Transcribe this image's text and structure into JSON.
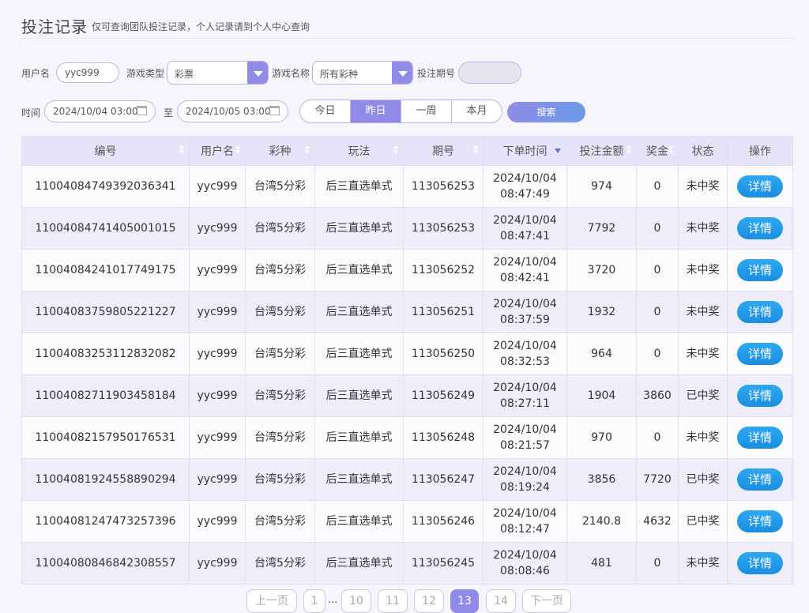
{
  "header": {
    "title": "投注记录",
    "subtitle": "仅可查询团队投注记录，个人记录请到个人中心查询"
  },
  "filters": {
    "username_label": "用户名",
    "username_value": "yyc999",
    "game_type_label": "游戏类型",
    "game_type_value": "彩票",
    "game_name_label": "游戏名称",
    "game_name_value": "所有彩种",
    "period_label": "投注期号",
    "period_value": "",
    "time_label": "时间",
    "time_from": "2024/10/04 03:00",
    "to_label": "至",
    "time_to": "2024/10/05 03:00",
    "ranges": [
      "今日",
      "昨日",
      "一周",
      "本月"
    ],
    "active_range": "昨日",
    "search_label": "搜索"
  },
  "table": {
    "columns": [
      "编号",
      "用户名",
      "彩种",
      "玩法",
      "期号",
      "下单时间",
      "投注金额",
      "奖金",
      "状态",
      "操作"
    ],
    "rows": [
      {
        "id": "11004084749392036341",
        "user": "yyc999",
        "lottery": "台湾5分彩",
        "play": "后三直选单式",
        "period": "113056253",
        "date": "2024/10/04",
        "time": "08:47:49",
        "amount": "974",
        "prize": "0",
        "status": "未中奖",
        "action": "详情"
      },
      {
        "id": "11004084741405001015",
        "user": "yyc999",
        "lottery": "台湾5分彩",
        "play": "后三直选单式",
        "period": "113056253",
        "date": "2024/10/04",
        "time": "08:47:41",
        "amount": "7792",
        "prize": "0",
        "status": "未中奖",
        "action": "详情"
      },
      {
        "id": "11004084241017749175",
        "user": "yyc999",
        "lottery": "台湾5分彩",
        "play": "后三直选单式",
        "period": "113056252",
        "date": "2024/10/04",
        "time": "08:42:41",
        "amount": "3720",
        "prize": "0",
        "status": "未中奖",
        "action": "详情"
      },
      {
        "id": "11004083759805221227",
        "user": "yyc999",
        "lottery": "台湾5分彩",
        "play": "后三直选单式",
        "period": "113056251",
        "date": "2024/10/04",
        "time": "08:37:59",
        "amount": "1932",
        "prize": "0",
        "status": "未中奖",
        "action": "详情"
      },
      {
        "id": "11004083253112832082",
        "user": "yyc999",
        "lottery": "台湾5分彩",
        "play": "后三直选单式",
        "period": "113056250",
        "date": "2024/10/04",
        "time": "08:32:53",
        "amount": "964",
        "prize": "0",
        "status": "未中奖",
        "action": "详情"
      },
      {
        "id": "11004082711903458184",
        "user": "yyc999",
        "lottery": "台湾5分彩",
        "play": "后三直选单式",
        "period": "113056249",
        "date": "2024/10/04",
        "time": "08:27:11",
        "amount": "1904",
        "prize": "3860",
        "status": "已中奖",
        "action": "详情"
      },
      {
        "id": "11004082157950176531",
        "user": "yyc999",
        "lottery": "台湾5分彩",
        "play": "后三直选单式",
        "period": "113056248",
        "date": "2024/10/04",
        "time": "08:21:57",
        "amount": "970",
        "prize": "0",
        "status": "未中奖",
        "action": "详情"
      },
      {
        "id": "11004081924558890294",
        "user": "yyc999",
        "lottery": "台湾5分彩",
        "play": "后三直选单式",
        "period": "113056247",
        "date": "2024/10/04",
        "time": "08:19:24",
        "amount": "3856",
        "prize": "7720",
        "status": "已中奖",
        "action": "详情"
      },
      {
        "id": "11004081247473257396",
        "user": "yyc999",
        "lottery": "台湾5分彩",
        "play": "后三直选单式",
        "period": "113056246",
        "date": "2024/10/04",
        "time": "08:12:47",
        "amount": "2140.8",
        "prize": "4632",
        "status": "已中奖",
        "action": "详情"
      },
      {
        "id": "11004080846842308557",
        "user": "yyc999",
        "lottery": "台湾5分彩",
        "play": "后三直选单式",
        "period": "113056245",
        "date": "2024/10/04",
        "time": "08:08:46",
        "amount": "481",
        "prize": "0",
        "status": "未中奖",
        "action": "详情"
      }
    ]
  },
  "colors": {
    "accent": "#8f8be6",
    "won": "#e0504a",
    "detail_button": "#1b8ee0"
  },
  "pagination": {
    "prev": "上一页",
    "first": "1",
    "ellipsis": "...",
    "pages": [
      "10",
      "11",
      "12",
      "13",
      "14"
    ],
    "active": "13",
    "next": "下一页"
  }
}
